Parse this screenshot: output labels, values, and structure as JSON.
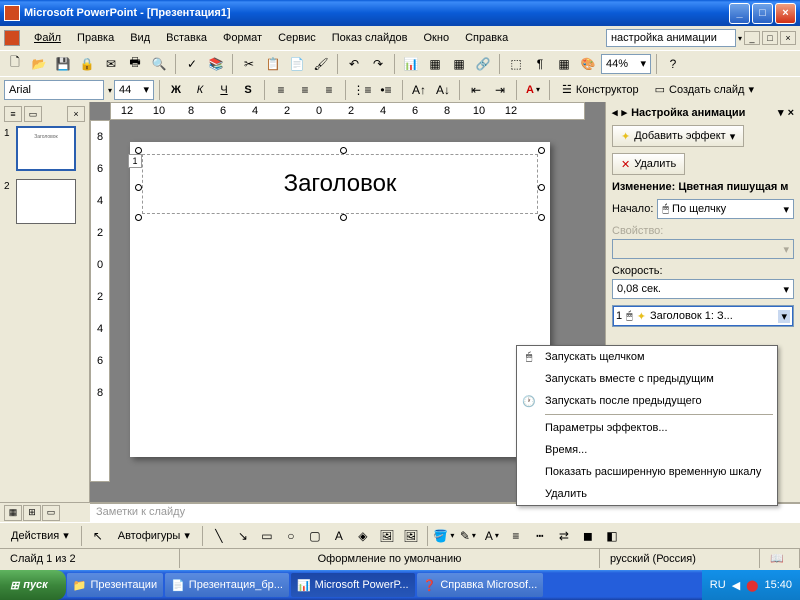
{
  "app": {
    "title": "Microsoft PowerPoint - [Презентация1]"
  },
  "menu": {
    "file": "Файл",
    "edit": "Правка",
    "view": "Вид",
    "insert": "Вставка",
    "format": "Формат",
    "tools": "Сервис",
    "slideshow": "Показ слайдов",
    "window": "Окно",
    "help": "Справка",
    "help_input": "настройка анимации"
  },
  "toolbar2": {
    "font": "Arial",
    "size": "44",
    "zoom": "44%",
    "designer": "Конструктор",
    "new_slide": "Создать слайд"
  },
  "ruler_h": [
    "12",
    "10",
    "8",
    "6",
    "4",
    "2",
    "0",
    "2",
    "4",
    "6",
    "8",
    "10",
    "12"
  ],
  "ruler_v": [
    "8",
    "6",
    "4",
    "2",
    "0",
    "2",
    "4",
    "6",
    "8"
  ],
  "slides": {
    "n1": "1",
    "n2": "2",
    "thumb1_text": "Заголовок"
  },
  "slide": {
    "title": "Заголовок",
    "tag": "1"
  },
  "anim": {
    "title": "Настройка анимации",
    "add_effect": "Добавить эффект",
    "remove": "Удалить",
    "change_label": "Изменение: Цветная пишущая м",
    "start_label": "Начало:",
    "start_value": "По щелчку",
    "property_label": "Свойство:",
    "speed_label": "Скорость:",
    "speed_value": "0,08 сек.",
    "item_num": "1",
    "item_text": "Заголовок 1: З..."
  },
  "ctx": {
    "on_click": "Запускать щелчком",
    "with_prev": "Запускать вместе с предыдущим",
    "after_prev": "Запускать после предыдущего",
    "effect_opts": "Параметры эффектов...",
    "timing": "Время...",
    "adv_timeline": "Показать расширенную временную шкалу",
    "remove": "Удалить"
  },
  "notes": {
    "placeholder": "Заметки к слайду"
  },
  "draw": {
    "actions": "Действия",
    "autoshapes": "Автофигуры"
  },
  "status": {
    "slide": "Слайд 1 из 2",
    "design": "Оформление по умолчанию",
    "lang": "русский (Россия)"
  },
  "taskbar": {
    "start": "пуск",
    "t1": "Презентации",
    "t2": "Презентация_бр...",
    "t3": "Microsoft PowerP...",
    "t4": "Справка Microsof...",
    "lang": "RU",
    "time": "15:40"
  }
}
